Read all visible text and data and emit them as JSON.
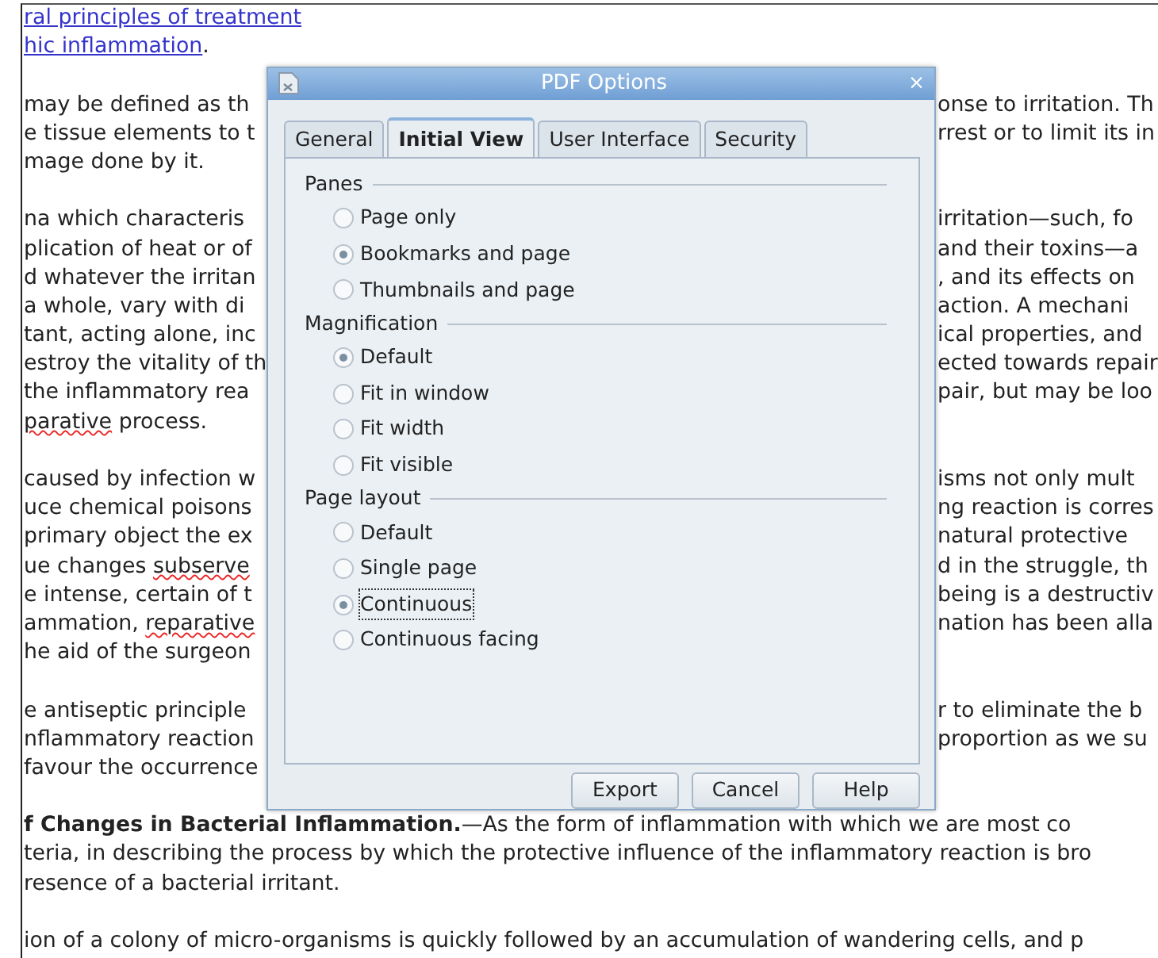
{
  "document": {
    "paragraphs": [
      {
        "lines": [
          {
            "left": [
              {
                "text": "ral principles of treatment",
                "kind": "link"
              }
            ]
          },
          {
            "left": [
              {
                "text": "hic inflammation",
                "kind": "link"
              },
              {
                "text": ".",
                "kind": "plain"
              }
            ]
          }
        ]
      },
      {
        "lines": [
          {
            "left": [
              {
                "text": "may be defined as th",
                "kind": "plain"
              }
            ],
            "right": "onse to irritation. Th"
          },
          {
            "left": [
              {
                "text": "e tissue elements to t",
                "kind": "plain"
              }
            ],
            "right": "rrest or to limit its in"
          },
          {
            "left": [
              {
                "text": "mage done by it.",
                "kind": "plain"
              }
            ]
          }
        ]
      },
      {
        "lines": [
          {
            "left": [
              {
                "text": "na which characteris",
                "kind": "plain"
              }
            ],
            "right": "irritation—such, fo"
          },
          {
            "left": [
              {
                "text": "plication of heat or of",
                "kind": "plain"
              }
            ],
            "right": "and their toxins—a"
          },
          {
            "left": [
              {
                "text": "d whatever the irritan",
                "kind": "plain"
              }
            ],
            "right": ", and its effects on"
          },
          {
            "left": [
              {
                "text": "a whole, vary with di",
                "kind": "plain"
              }
            ],
            "right": "action. A mechani"
          },
          {
            "left": [
              {
                "text": "tant, acting alone, inc",
                "kind": "plain"
              }
            ],
            "right": "ical properties, and"
          },
          {
            "left": [
              {
                "text": "estroy the vitality of th",
                "kind": "plain"
              }
            ],
            "right": "ected towards repair"
          },
          {
            "left": [
              {
                "text": "the inflammatory rea",
                "kind": "plain"
              }
            ],
            "right": "pair, but may be loo"
          },
          {
            "left": [
              {
                "text": "parative",
                "kind": "misspelled"
              },
              {
                "text": " process.",
                "kind": "plain"
              }
            ]
          }
        ]
      },
      {
        "lines": [
          {
            "left": [
              {
                "text": "caused by infection w",
                "kind": "plain"
              }
            ],
            "right": "isms not only mult"
          },
          {
            "left": [
              {
                "text": "uce chemical poisons",
                "kind": "plain"
              }
            ],
            "right": "ng reaction is corres"
          },
          {
            "left": [
              {
                "text": "primary object the ex",
                "kind": "plain"
              }
            ],
            "right": "natural protective"
          },
          {
            "left": [
              {
                "text": "ue changes ",
                "kind": "plain"
              },
              {
                "text": "subserve",
                "kind": "misspelled"
              }
            ],
            "right": "d in the struggle, th"
          },
          {
            "left": [
              {
                "text": "e intense, certain of t",
                "kind": "plain"
              }
            ],
            "right": "being is a destructiv"
          },
          {
            "left": [
              {
                "text": "ammation, ",
                "kind": "plain"
              },
              {
                "text": "reparative",
                "kind": "misspelled"
              }
            ],
            "right": "nation has been alla"
          },
          {
            "left": [
              {
                "text": "he aid of the surgeon",
                "kind": "plain"
              }
            ]
          }
        ]
      },
      {
        "lines": [
          {
            "left": [
              {
                "text": "e antiseptic principle",
                "kind": "plain"
              }
            ],
            "right": "r to eliminate the b"
          },
          {
            "left": [
              {
                "text": "nflammatory reaction",
                "kind": "plain"
              }
            ],
            "right": "proportion as we su"
          },
          {
            "left": [
              {
                "text": "favour the occurrence",
                "kind": "plain"
              }
            ]
          }
        ]
      },
      {
        "lines": [
          {
            "full": "**f Changes in Bacterial Inflammation.**—As the form of inflammation with which we are most co"
          },
          {
            "full": "teria, in describing the process by which the protective influence of the inflammatory reaction is bro"
          },
          {
            "full": "resence of a bacterial irritant."
          }
        ]
      },
      {
        "lines": [
          {
            "full": "ion of a colony of micro-organisms is quickly followed by an accumulation of wandering cells, and p"
          }
        ]
      }
    ]
  },
  "dialog": {
    "title": "PDF Options",
    "close": "×",
    "tabs": [
      {
        "label": "General",
        "selected": false
      },
      {
        "label": "Initial View",
        "selected": true
      },
      {
        "label": "User Interface",
        "selected": false
      },
      {
        "label": "Security",
        "selected": false
      }
    ],
    "groups": [
      {
        "title": "Panes",
        "options": [
          {
            "label": "Page only",
            "selected": false
          },
          {
            "label": "Bookmarks and page",
            "selected": true
          },
          {
            "label": "Thumbnails and page",
            "selected": false
          }
        ]
      },
      {
        "title": "Magnification",
        "options": [
          {
            "label": "Default",
            "selected": true
          },
          {
            "label": "Fit in window",
            "selected": false
          },
          {
            "label": "Fit width",
            "selected": false
          },
          {
            "label": "Fit visible",
            "selected": false
          }
        ]
      },
      {
        "title": "Page layout",
        "options": [
          {
            "label": "Default",
            "selected": false
          },
          {
            "label": "Single page",
            "selected": false
          },
          {
            "label": "Continuous",
            "selected": true
          },
          {
            "label": "Continuous facing",
            "selected": false
          }
        ]
      }
    ],
    "buttons": [
      "Export",
      "Cancel",
      "Help"
    ]
  }
}
